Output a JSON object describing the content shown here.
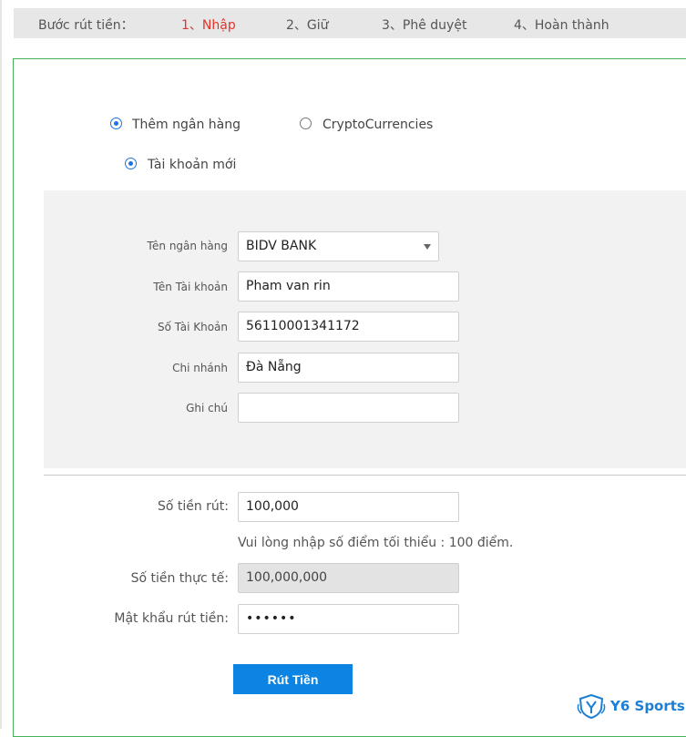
{
  "steps": {
    "title": "Bước rút tiền：",
    "items": [
      "1、Nhập",
      "2、Giữ",
      "3、Phê duyệt",
      "4、Hoàn thành"
    ]
  },
  "method": {
    "bank_label": "Thêm ngân hàng",
    "crypto_label": "CryptoCurrencies",
    "new_account_label": "Tài khoản mới",
    "selected": "Thêm ngân hàng"
  },
  "bank_form": {
    "bank_name_label": "Tên ngân hàng",
    "bank_name_value": "BIDV BANK",
    "account_name_label": "Tên Tài khoản",
    "account_name_value": "Pham van rin",
    "account_number_label": "Số Tài Khoản",
    "account_number_value": "56110001341172",
    "branch_label": "Chi nhánh",
    "branch_value": "Đà Nẵng",
    "note_label": "Ghi chú",
    "note_value": ""
  },
  "withdraw": {
    "amount_label": "Số tiền rút:",
    "amount_value": "100,000",
    "hint": "Vui lòng nhập số điểm tối thiểu : 100 điểm.",
    "actual_label": "Số tiền thực tế:",
    "actual_value": "100,000,000",
    "password_label": "Mật khẩu rút tiền:",
    "password_value": "••••••",
    "submit_label": "Rút Tiền"
  },
  "brand": {
    "name": "Y6 Sports",
    "color": "#1d7fd3"
  },
  "colors": {
    "accent": "#0b84e3",
    "active_step": "#e0342a",
    "frame": "#46b35a"
  }
}
